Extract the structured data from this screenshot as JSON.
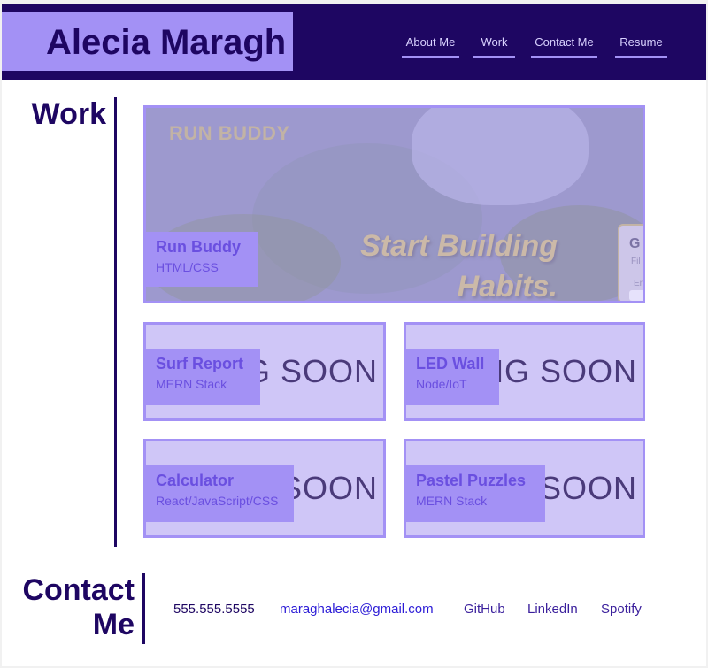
{
  "header": {
    "name": "Alecia Maragh",
    "nav": [
      {
        "label": "About Me"
      },
      {
        "label": "Work"
      },
      {
        "label": "Contact Me"
      },
      {
        "label": "Resume"
      }
    ]
  },
  "work": {
    "title": "Work",
    "featured": {
      "brand": "RUN BUDDY",
      "tagline_line1": "Start Building",
      "tagline_line2": "Habits.",
      "form_letter": "G",
      "form_line1": "Fil",
      "form_line2": "Er",
      "title": "Run Buddy",
      "tech": "HTML/CSS"
    },
    "projects": [
      {
        "title": "Surf Report",
        "tech": "MERN Stack",
        "bg_text": "G SOON"
      },
      {
        "title": "LED Wall",
        "tech": "Node/IoT",
        "bg_text": "NG SOON"
      },
      {
        "title": "Calculator",
        "tech": "React/JavaScript/CSS",
        "bg_text": "SOON"
      },
      {
        "title": "Pastel Puzzles",
        "tech": "MERN Stack",
        "bg_text": "SOON"
      }
    ]
  },
  "contact": {
    "title_line1": "Contact",
    "title_line2": "Me",
    "phone": "555.555.5555",
    "email": "maraghalecia@gmail.com",
    "links": [
      {
        "label": "GitHub"
      },
      {
        "label": "LinkedIn"
      },
      {
        "label": "Spotify"
      }
    ]
  },
  "colors": {
    "primary": "#1e0662",
    "accent": "#a391f5",
    "card_bg": "#cfc6f7",
    "label_text": "#6a4fe0",
    "email_link": "#2b1bd6"
  }
}
